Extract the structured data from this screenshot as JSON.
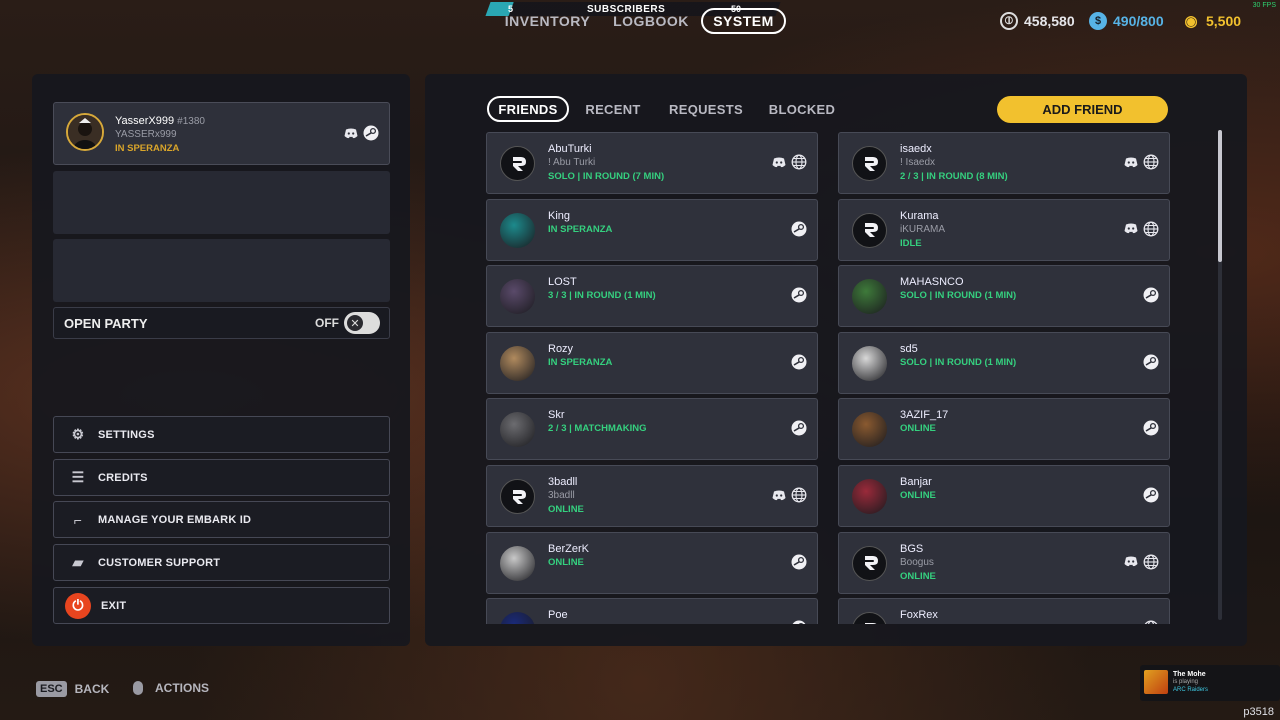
{
  "top": {
    "subscribers_left": "5",
    "subscribers_label": "SUBSCRIBERS",
    "subscribers_right": "50",
    "tabs": [
      "INVENTORY",
      "LOGBOOK",
      "SYSTEM"
    ],
    "active_tab": "SYSTEM",
    "currency": [
      {
        "icon": "coin-stack-icon",
        "value": "458,580",
        "color": "#ffffff"
      },
      {
        "icon": "cred-icon",
        "value": "490/800",
        "color": "#57b3e6"
      },
      {
        "icon": "raider-token-icon",
        "value": "5,500",
        "color": "#f2c12e"
      }
    ],
    "fps": "30 FPS"
  },
  "user": {
    "name": "YasserX999",
    "tag": "#1380",
    "sub": "YASSERx999",
    "status": "IN SPERANZA"
  },
  "open_party": {
    "label": "OPEN PARTY",
    "value": "OFF"
  },
  "menu": [
    {
      "label": "SETTINGS",
      "icon": "gear-icon"
    },
    {
      "label": "CREDITS",
      "icon": "list-icon"
    },
    {
      "label": "MANAGE YOUR EMBARK ID",
      "icon": "id-icon"
    },
    {
      "label": "CUSTOMER SUPPORT",
      "icon": "chat-icon"
    },
    {
      "label": "EXIT",
      "icon": "power-icon"
    }
  ],
  "friend_tabs": [
    "FRIENDS",
    "RECENT",
    "REQUESTS",
    "BLOCKED"
  ],
  "add_friend": "ADD FRIEND",
  "friends_left": [
    {
      "name": "AbuTurki",
      "sub": "! Abu Turki",
      "status": "SOLO | IN ROUND (7 MIN)",
      "icons": [
        "discord",
        "globe"
      ],
      "avatar": "embark"
    },
    {
      "name": "King",
      "sub": "",
      "status": "IN SPERANZA",
      "icons": [
        "steam"
      ],
      "avatar": "teal"
    },
    {
      "name": "LOST",
      "sub": "",
      "status": "3 / 3 | IN ROUND (1 MIN)",
      "icons": [
        "steam"
      ],
      "avatar": "purple"
    },
    {
      "name": "Rozy",
      "sub": "",
      "status": "IN SPERANZA",
      "icons": [
        "steam"
      ],
      "avatar": "tan"
    },
    {
      "name": "Skr",
      "sub": "",
      "status": "2 / 3 | MATCHMAKING",
      "icons": [
        "steam"
      ],
      "avatar": "grey"
    },
    {
      "name": "3badll",
      "sub": "3badll",
      "status": "ONLINE",
      "icons": [
        "discord",
        "globe"
      ],
      "avatar": "embark"
    },
    {
      "name": "BerZerK",
      "sub": "",
      "status": "ONLINE",
      "icons": [
        "steam"
      ],
      "avatar": "light"
    },
    {
      "name": "Poe",
      "sub": "",
      "status": "",
      "icons": [
        "steam"
      ],
      "avatar": "navy"
    }
  ],
  "friends_right": [
    {
      "name": "isaedx",
      "sub": "!          Isaedx",
      "status": "2 / 3 | IN ROUND (8 MIN)",
      "icons": [
        "discord",
        "globe"
      ],
      "avatar": "embark"
    },
    {
      "name": "Kurama",
      "sub": "iKURAMA",
      "status": "IDLE",
      "icons": [
        "discord",
        "globe"
      ],
      "avatar": "embark"
    },
    {
      "name": "MAHASNCO",
      "sub": "",
      "status": "SOLO | IN ROUND (1 MIN)",
      "icons": [
        "steam"
      ],
      "avatar": "green"
    },
    {
      "name": "sd5",
      "sub": "",
      "status": "SOLO | IN ROUND (1 MIN)",
      "icons": [
        "steam"
      ],
      "avatar": "white"
    },
    {
      "name": "3AZIF_17",
      "sub": "",
      "status": "ONLINE",
      "icons": [
        "steam"
      ],
      "avatar": "brown"
    },
    {
      "name": "Banjar",
      "sub": "",
      "status": "ONLINE",
      "icons": [
        "steam"
      ],
      "avatar": "red"
    },
    {
      "name": "BGS",
      "sub": "Boogus",
      "status": "ONLINE",
      "icons": [
        "discord",
        "globe"
      ],
      "avatar": "embark"
    },
    {
      "name": "FoxRex",
      "sub": "",
      "status": "",
      "icons": [
        "globe"
      ],
      "avatar": "embark"
    }
  ],
  "bottom": {
    "back_key": "ESC",
    "back": "BACK",
    "actions": "ACTIONS"
  },
  "notification": {
    "title": "The Mohe",
    "line": "is playing",
    "game": "ARC Raiders"
  },
  "user_id": "p3518"
}
